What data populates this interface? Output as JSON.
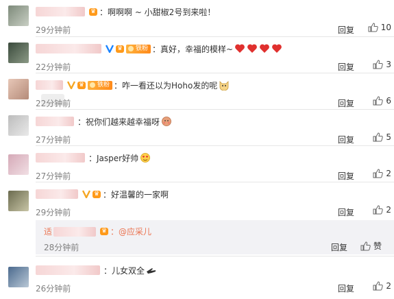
{
  "comments": [
    {
      "text": "：啊啊啊 ~ 小甜椒2号到来啦！",
      "time": "29分钟前",
      "reply": "回复",
      "likes": "10",
      "badges": [
        "vip"
      ],
      "emoji": []
    },
    {
      "text": "：真好，幸福的模样~",
      "time": "22分钟前",
      "reply": "回复",
      "likes": "3",
      "badges": [
        "blue-v",
        "vip",
        "fans"
      ],
      "emoji": [
        "heart",
        "heart",
        "heart",
        "heart"
      ]
    },
    {
      "text": "：咋一看还以为Hoho发的呢",
      "time": "22分钟前",
      "reply": "回复",
      "likes": "6",
      "badges": [
        "gold-v",
        "vip",
        "fans"
      ],
      "emoji": [
        "cat"
      ]
    },
    {
      "text": "：祝你们越来越幸福呀",
      "time": "27分钟前",
      "reply": "回复",
      "likes": "5",
      "badges": [],
      "emoji": [
        "shy"
      ]
    },
    {
      "text": "：Jasper好帅",
      "time": "27分钟前",
      "reply": "回复",
      "likes": "2",
      "badges": [],
      "emoji": [
        "love-eyes"
      ]
    },
    {
      "text": "：好温馨的一家啊",
      "time": "29分钟前",
      "reply": "回复",
      "likes": "2",
      "badges": [
        "gold-v",
        "vip"
      ],
      "emoji": []
    },
    {
      "text": "：儿女双全",
      "time": "26分钟前",
      "reply": "回复",
      "likes": "2",
      "badges": [],
      "emoji": [
        "hand"
      ]
    }
  ],
  "sub_reply": {
    "name_visible": "适",
    "mention": "：@应采儿",
    "time": "28分钟前",
    "reply": "回复",
    "like": "赞"
  },
  "colors": {
    "link": "#eb7350",
    "muted": "#808080",
    "heart": "#e0302e"
  }
}
